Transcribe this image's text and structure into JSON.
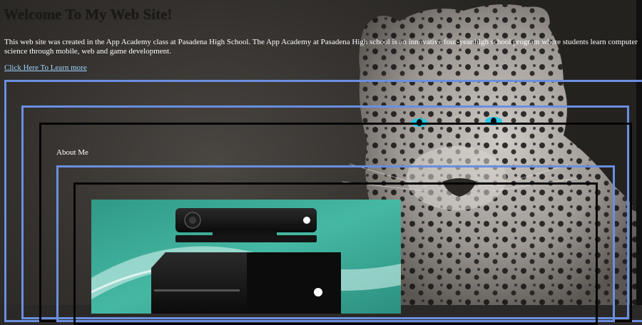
{
  "header": {
    "title": "Welcome To My Web Site!",
    "intro": "This web site was created in the App Academy class at Pasadena High School. The App Academy at Pasadena High school is an innovative four-year high school program where students learn computer science through mobile, web and game development.",
    "link_label": "Click Here To Learn more"
  },
  "section": {
    "about_label": "About Me"
  },
  "images": {
    "background": "leopard-photo",
    "content": "xbox-console-photo"
  },
  "colors": {
    "frame_blue": "#6b8fe0",
    "frame_black": "#050505",
    "link": "#9fd4ff",
    "teal": "#3aa894"
  }
}
